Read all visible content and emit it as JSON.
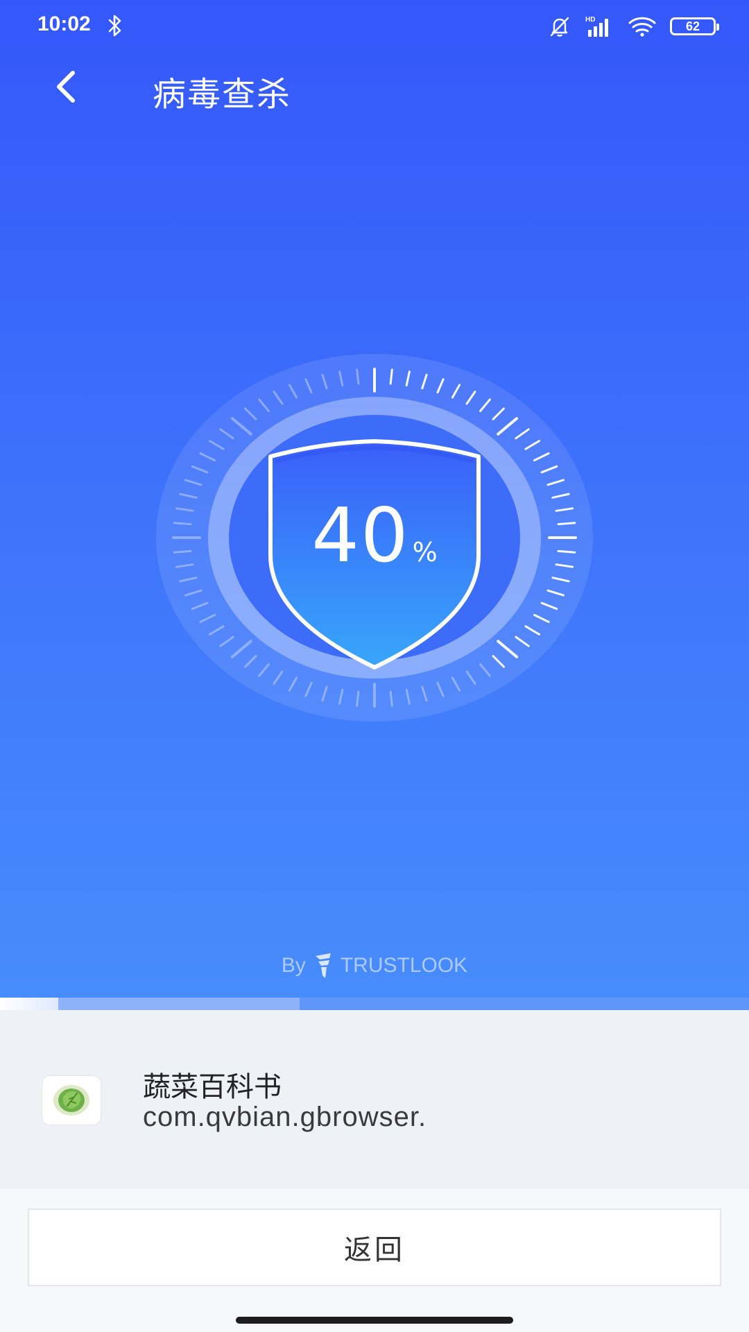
{
  "status_bar": {
    "time": "10:02",
    "battery": "62"
  },
  "header": {
    "title": "病毒查杀"
  },
  "scan": {
    "progress_value": "40",
    "progress_unit": "%",
    "bar_fraction": 0.4
  },
  "credit": {
    "by": "By",
    "brand": "TRUSTLOOK"
  },
  "current_item": {
    "app_name": "蔬菜百科书",
    "package": "com.qvbian.gbrowser.",
    "icon": "lettuce-icon"
  },
  "actions": {
    "return_label": "返回"
  },
  "colors": {
    "primary_top": "#3457fa",
    "primary_bottom": "#478cfc",
    "scan_bg": "#eef1f5"
  }
}
